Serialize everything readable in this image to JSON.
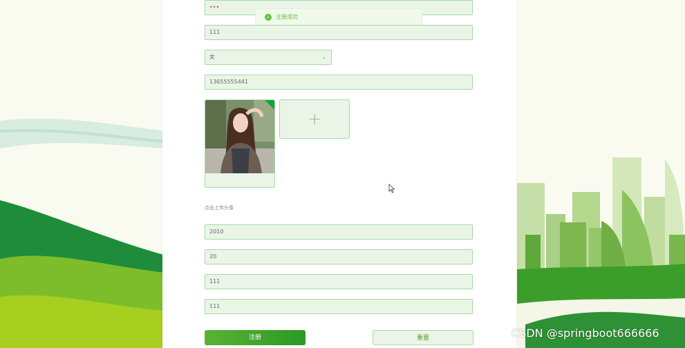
{
  "toast": {
    "icon": "check-circle-icon",
    "message": "注册成功"
  },
  "form": {
    "password_confirm_value": "•••",
    "password_plain_value": "111",
    "gender_value": "女",
    "phone_value": "13655555441",
    "avatar": {
      "uploaded_image": "portrait-photo",
      "add_icon": "plus-icon"
    },
    "upload_hint": "点击上传头像",
    "field_2010": "2010",
    "field_20": "20",
    "field_111_a": "111",
    "field_111_b": "111"
  },
  "buttons": {
    "register_label": "注册",
    "reset_label": "重置"
  },
  "watermark": "CSDN @springboot666666",
  "colors": {
    "accent": "#2a9a25",
    "field_bg": "#eaf5e8",
    "field_border": "#a7d8a4",
    "success": "#67c23a"
  }
}
